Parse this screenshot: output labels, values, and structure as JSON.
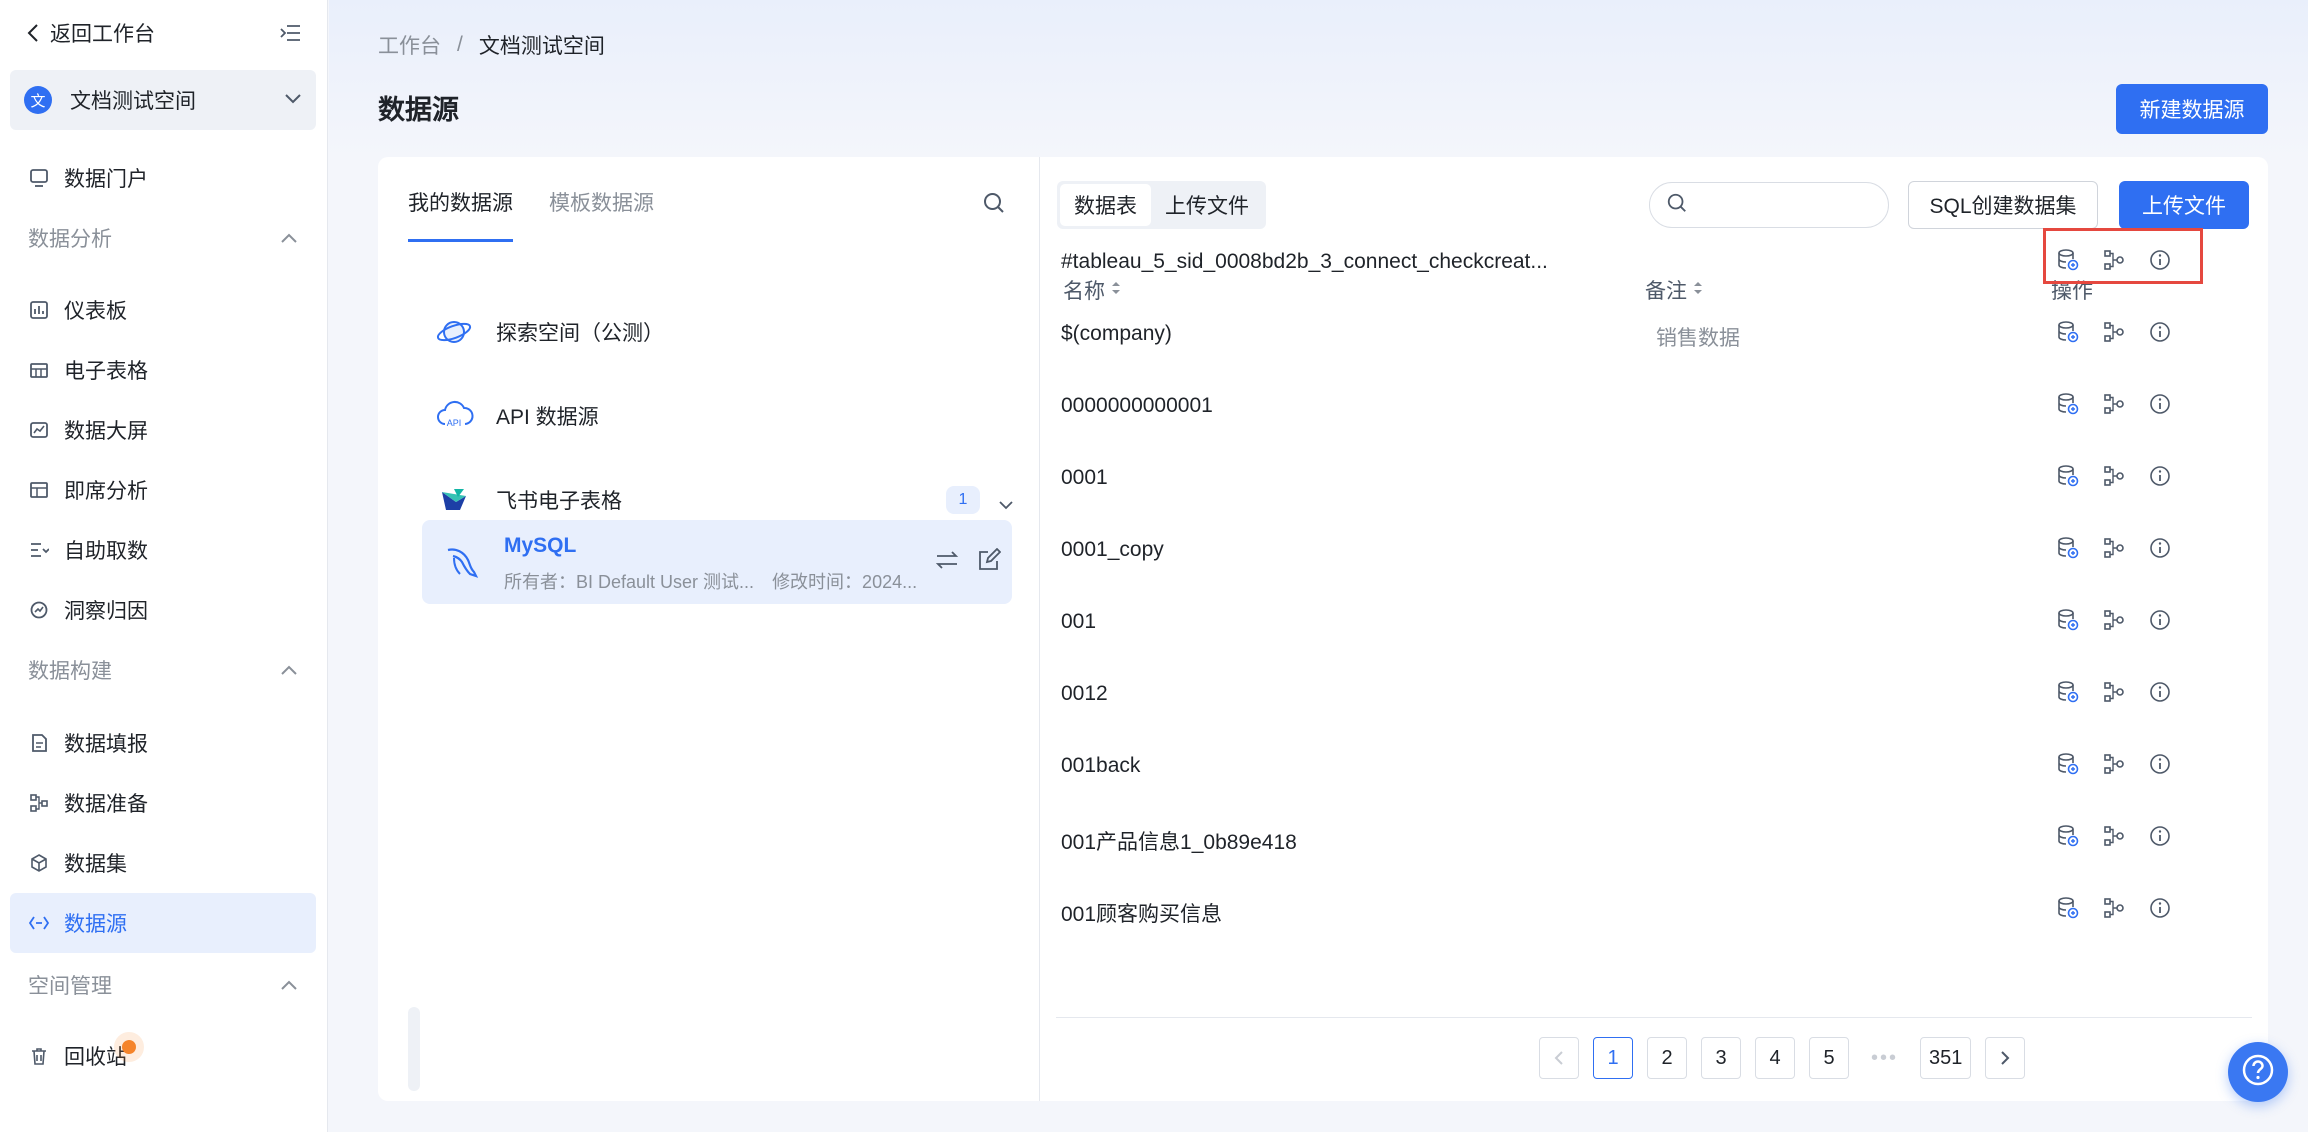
{
  "sidebar": {
    "back_label": "返回工作台",
    "space": {
      "badge": "文",
      "name": "文档测试空间"
    },
    "items": [
      {
        "label": "数据门户"
      },
      {
        "group": "数据分析"
      },
      {
        "label": "仪表板"
      },
      {
        "label": "电子表格"
      },
      {
        "label": "数据大屏"
      },
      {
        "label": "即席分析"
      },
      {
        "label": "自助取数"
      },
      {
        "label": "洞察归因"
      },
      {
        "group": "数据构建"
      },
      {
        "label": "数据填报"
      },
      {
        "label": "数据准备"
      },
      {
        "label": "数据集"
      },
      {
        "label": "数据源"
      },
      {
        "group": "空间管理"
      },
      {
        "label": "回收站"
      }
    ]
  },
  "header": {
    "breadcrumb": [
      "工作台",
      "/",
      "文档测试空间"
    ],
    "title": "数据源",
    "new_button": "新建数据源"
  },
  "left_panel": {
    "tabs": [
      "我的数据源",
      "模板数据源"
    ],
    "sources": [
      {
        "name": "探索空间（公测）",
        "icon": "planet-icon"
      },
      {
        "name": "API 数据源",
        "icon": "api-cloud-icon"
      },
      {
        "name": "飞书电子表格",
        "icon": "feishu-icon",
        "count": "1"
      }
    ],
    "active_source": {
      "name": "MySQL",
      "owner": "所有者：BI Default User 测试...",
      "modified": "修改时间：2024..."
    }
  },
  "right_panel": {
    "segments": [
      "数据表",
      "上传文件"
    ],
    "search_placeholder": "",
    "sql_button": "SQL创建数据集",
    "upload_button": "上传文件",
    "columns": {
      "name": "名称",
      "remark": "备注",
      "ops": "操作"
    },
    "rows": [
      {
        "name": "#tableau_5_sid_0008bd2b_3_connect_checkcreat...",
        "remark": ""
      },
      {
        "name": "$(company)",
        "remark": "销售数据"
      },
      {
        "name": "0000000000001",
        "remark": ""
      },
      {
        "name": "0001",
        "remark": ""
      },
      {
        "name": "0001_copy",
        "remark": ""
      },
      {
        "name": "001",
        "remark": ""
      },
      {
        "name": "0012",
        "remark": ""
      },
      {
        "name": "001back",
        "remark": ""
      },
      {
        "name": "001产品信息1_0b89e418",
        "remark": ""
      },
      {
        "name": "001顾客购买信息",
        "remark": ""
      }
    ],
    "pagination": {
      "pages": [
        "1",
        "2",
        "3",
        "4",
        "5"
      ],
      "ellipsis": "•••",
      "last": "351",
      "current": "1"
    }
  },
  "colors": {
    "accent": "#2f6ff2",
    "highlight": "#e5483f"
  }
}
